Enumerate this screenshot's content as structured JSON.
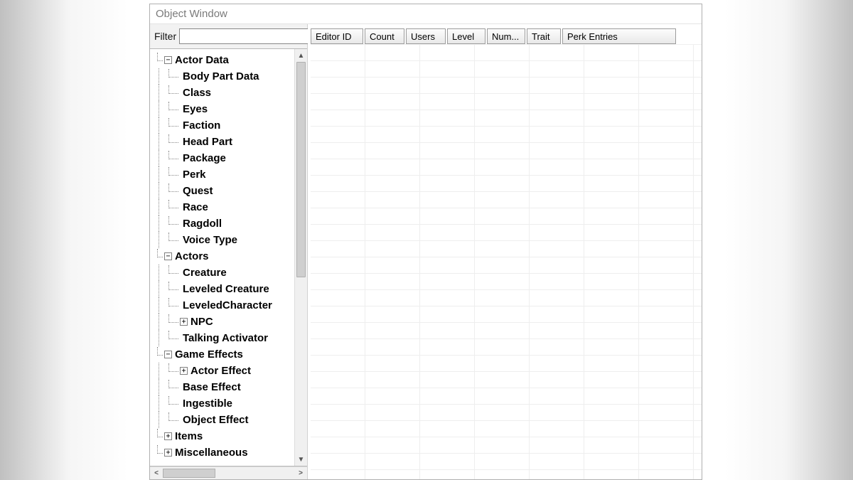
{
  "window": {
    "title": "Object Window"
  },
  "filter": {
    "label": "Filter",
    "value": ""
  },
  "tree": [
    {
      "depth": 0,
      "expand": "-",
      "label": "Actor Data"
    },
    {
      "depth": 1,
      "expand": null,
      "label": "Body Part Data"
    },
    {
      "depth": 1,
      "expand": null,
      "label": "Class"
    },
    {
      "depth": 1,
      "expand": null,
      "label": "Eyes"
    },
    {
      "depth": 1,
      "expand": null,
      "label": "Faction"
    },
    {
      "depth": 1,
      "expand": null,
      "label": "Head Part"
    },
    {
      "depth": 1,
      "expand": null,
      "label": "Package"
    },
    {
      "depth": 1,
      "expand": null,
      "label": "Perk"
    },
    {
      "depth": 1,
      "expand": null,
      "label": "Quest"
    },
    {
      "depth": 1,
      "expand": null,
      "label": "Race"
    },
    {
      "depth": 1,
      "expand": null,
      "label": "Ragdoll"
    },
    {
      "depth": 1,
      "expand": null,
      "label": "Voice Type"
    },
    {
      "depth": 0,
      "expand": "-",
      "label": "Actors"
    },
    {
      "depth": 1,
      "expand": null,
      "label": "Creature"
    },
    {
      "depth": 1,
      "expand": null,
      "label": "Leveled Creature"
    },
    {
      "depth": 1,
      "expand": null,
      "label": "LeveledCharacter"
    },
    {
      "depth": 1,
      "expand": "+",
      "label": "NPC"
    },
    {
      "depth": 1,
      "expand": null,
      "label": "Talking Activator"
    },
    {
      "depth": 0,
      "expand": "-",
      "label": "Game Effects"
    },
    {
      "depth": 1,
      "expand": "+",
      "label": "Actor Effect"
    },
    {
      "depth": 1,
      "expand": null,
      "label": "Base Effect"
    },
    {
      "depth": 1,
      "expand": null,
      "label": "Ingestible"
    },
    {
      "depth": 1,
      "expand": null,
      "label": "Object Effect"
    },
    {
      "depth": 0,
      "expand": "+",
      "label": "Items"
    },
    {
      "depth": 0,
      "expand": "+",
      "label": "Miscellaneous"
    }
  ],
  "columns": [
    {
      "label": "Editor ID",
      "width": 74
    },
    {
      "label": "Count",
      "width": 56
    },
    {
      "label": "Users",
      "width": 56
    },
    {
      "label": "Level",
      "width": 54
    },
    {
      "label": "Num...",
      "width": 54
    },
    {
      "label": "Trait",
      "width": 48
    },
    {
      "label": "Perk Entries",
      "width": 160
    }
  ]
}
